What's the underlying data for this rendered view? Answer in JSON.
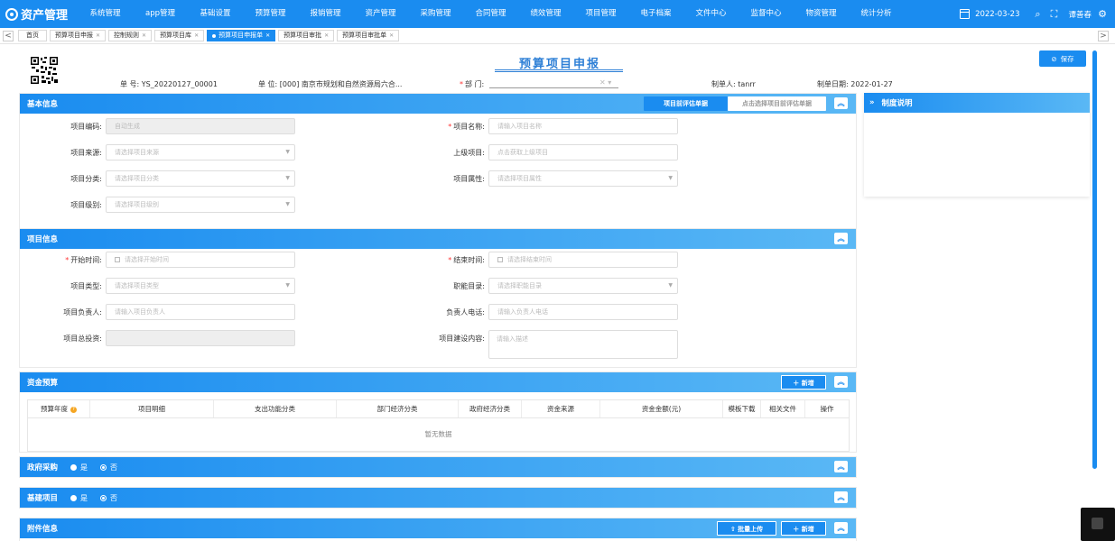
{
  "app": {
    "title": "资产管理"
  },
  "nav": {
    "items": [
      "系统管理",
      "app管理",
      "基础设置",
      "预算管理",
      "报销管理",
      "资产管理",
      "采购管理",
      "合同管理",
      "绩效管理",
      "项目管理",
      "电子档案",
      "文件中心",
      "监督中心",
      "物资管理",
      "统计分析"
    ],
    "date": "2022-03-23",
    "user": "谭善春"
  },
  "tabs": {
    "items": [
      {
        "label": "首页",
        "closable": false
      },
      {
        "label": "预算项目申报",
        "closable": true
      },
      {
        "label": "控制规则",
        "closable": true
      },
      {
        "label": "预算项目库",
        "closable": true
      },
      {
        "label": "预算项目申报单",
        "closable": true,
        "active": true
      },
      {
        "label": "预算项目审批",
        "closable": true
      },
      {
        "label": "预算项目审批单",
        "closable": true
      }
    ],
    "prev": "<",
    "next": ">"
  },
  "header": {
    "title": "预算项目申报",
    "save": "保存",
    "doc_no_label": "单 号:",
    "doc_no": "YS_20220127_00001",
    "unit_label": "单 位:",
    "unit": "[000] 南京市规划和自然资源局六合...",
    "dept_label": "部 门:",
    "maker_label": "制单人:",
    "maker": "tanrr",
    "date_label": "制单日期:",
    "date": "2022-01-27"
  },
  "basic": {
    "title": "基本信息",
    "btn_pre": "项目前评估单据",
    "btn_select": "点击选择项目前评估单据",
    "code_label": "项目编码:",
    "code_ph": "自动生成",
    "name_label": "项目名称:",
    "name_ph": "请输入项目名称",
    "source_label": "项目来源:",
    "source_ph": "请选择项目来源",
    "parent_label": "上级项目:",
    "parent_ph": "点击获取上级项目",
    "category_label": "项目分类:",
    "category_ph": "请选择项目分类",
    "attr_label": "项目属性:",
    "attr_ph": "请选择项目属性",
    "level_label": "项目级别:",
    "level_ph": "请选择项目级别"
  },
  "project": {
    "title": "项目信息",
    "start_label": "开始时间:",
    "start_ph": "请选择开始时间",
    "end_label": "结束时间:",
    "end_ph": "请选择结束时间",
    "type_label": "项目类型:",
    "type_ph": "请选择项目类型",
    "duty_label": "职能目录:",
    "duty_ph": "请选择职能目录",
    "owner_label": "项目负责人:",
    "owner_ph": "请输入项目负责人",
    "phone_label": "负责人电话:",
    "phone_ph": "请输入负责人电话",
    "invest_label": "项目总投资:",
    "content_label": "项目建设内容:",
    "content_ph": "请输入描述"
  },
  "budget": {
    "title": "资金预算",
    "add": "新增",
    "columns": [
      "预算年度",
      "项目明细",
      "支出功能分类",
      "部门经济分类",
      "政府经济分类",
      "资金来源",
      "资金金额(元)",
      "模板下载",
      "相关文件",
      "操作"
    ],
    "empty": "暂无数据"
  },
  "procure": {
    "title": "政府采购",
    "yes": "是",
    "no": "否"
  },
  "build": {
    "title": "基建项目",
    "yes": "是",
    "no": "否"
  },
  "attach": {
    "title": "附件信息",
    "upload": "批量上传",
    "add": "新增"
  },
  "side": {
    "title": "制度说明"
  },
  "colors": {
    "primary": "#1a8cf0",
    "header_gradient_end": "#5ab8f5",
    "required": "#ff3333"
  }
}
